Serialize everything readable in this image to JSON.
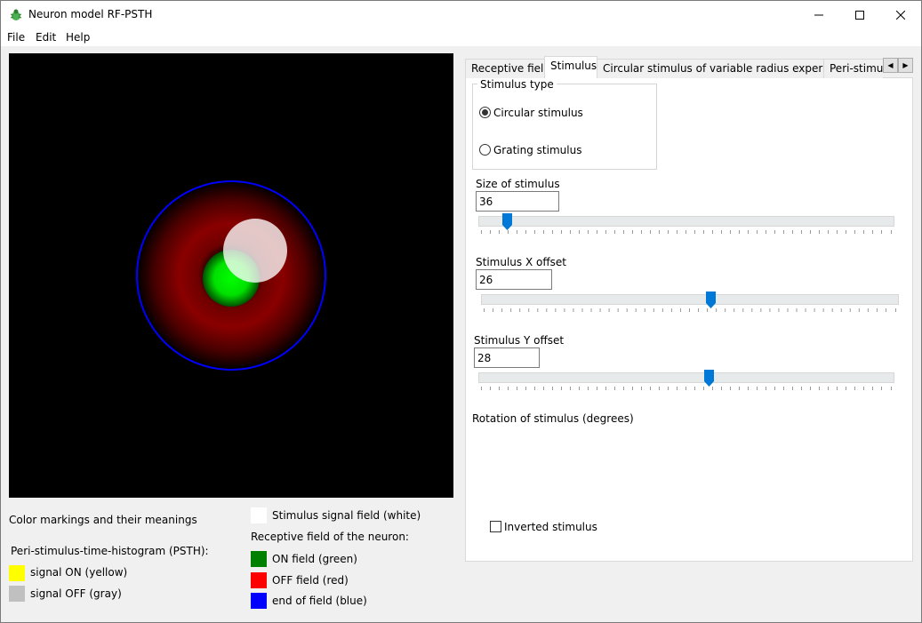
{
  "window": {
    "title": "Neuron model RF-PSTH"
  },
  "menu": [
    "File",
    "Edit",
    "Help"
  ],
  "legend": {
    "heading": "Color markings and their meanings",
    "psth_title": "Peri-stimulus-time-histogram (PSTH):",
    "signal_on": "signal ON (yellow)",
    "signal_off": "signal OFF (gray)",
    "stimulus_field": "Stimulus signal field (white)",
    "rf_title": "Receptive field of the neuron:",
    "on_field": "ON field (green)",
    "off_field": "OFF field (red)",
    "end_field": "end of field (blue)",
    "colors": {
      "yellow": "#ffff00",
      "gray": "#c0c0c0",
      "white": "#ffffff",
      "green": "#008000",
      "red": "#ff0000",
      "blue": "#0000ff"
    }
  },
  "tabs": [
    "Receptive field",
    "Stimulus",
    "Circular stimulus of variable radius experiment",
    "Peri-stimul"
  ],
  "active_tab": "Stimulus",
  "stimulus": {
    "type_group": "Stimulus type",
    "circular_label": "Circular stimulus",
    "grating_label": "Grating stimulus",
    "selected_type": "Circular stimulus",
    "size_label": "Size of stimulus",
    "size_value": "36",
    "x_label": "Stimulus X offset",
    "x_value": "26",
    "y_label": "Stimulus Y offset",
    "y_value": "28",
    "rotation_label": "Rotation of stimulus (degrees)",
    "inverted_label": "Inverted stimulus",
    "inverted_checked": false
  },
  "icons": {
    "app": "bug-icon",
    "minimize": "minimize-icon",
    "maximize": "maximize-icon",
    "close": "close-icon",
    "tab_left": "arrow-left-icon",
    "tab_right": "arrow-right-icon"
  }
}
